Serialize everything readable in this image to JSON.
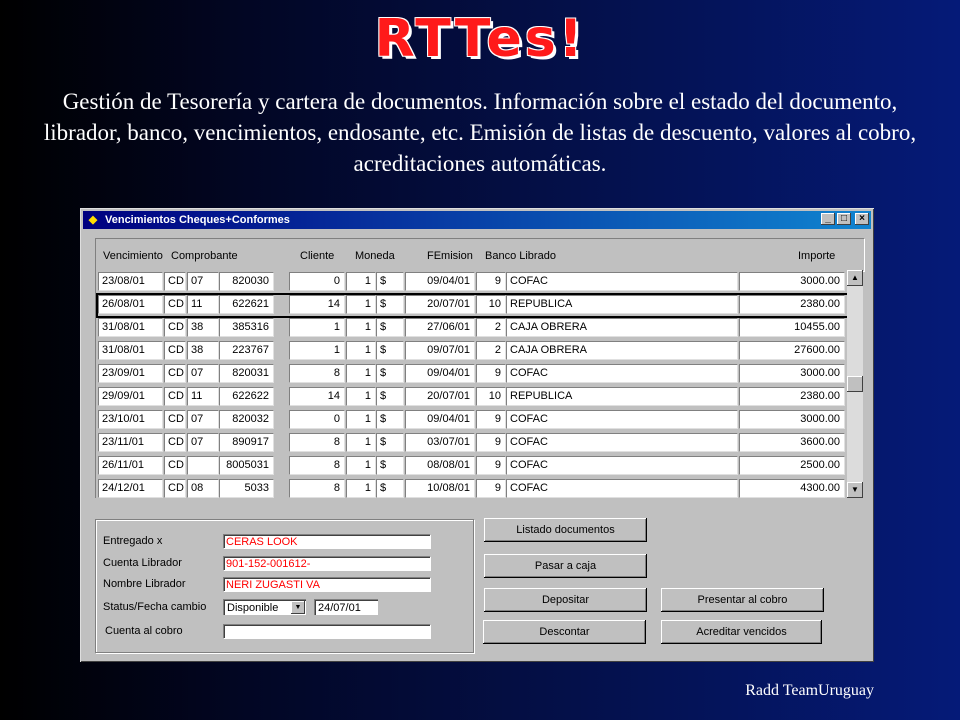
{
  "slide": {
    "title": "RTTes!",
    "description": "Gestión de Tesorería y cartera de documentos.  Información sobre el estado del documento, librador, banco, vencimientos, endosante, etc. Emisión de listas de descuento, valores al cobro, acreditaciones automáticas.",
    "footer": "Radd TeamUruguay"
  },
  "window": {
    "title": "Vencimientos Cheques+Conformes",
    "minimize": "_",
    "maximize": "□",
    "close": "×"
  },
  "columns": {
    "vencimiento": "Vencimiento",
    "comprobante": "Comprobante",
    "cliente": "Cliente",
    "moneda": "Moneda",
    "femision": "FEmision",
    "banco": "Banco Librado",
    "importe": "Importe"
  },
  "rows": [
    {
      "venc": "23/08/01",
      "tipo": "CD",
      "serie": "07",
      "numero": "820030",
      "cliente": "0",
      "mon": "1",
      "signo": "$",
      "femision": "09/04/01",
      "bcod": "9",
      "banco": "COFAC",
      "importe": "3000.00"
    },
    {
      "venc": "26/08/01",
      "tipo": "CD",
      "serie": "11",
      "numero": "622621",
      "cliente": "14",
      "mon": "1",
      "signo": "$",
      "femision": "20/07/01",
      "bcod": "10",
      "banco": "REPUBLICA",
      "importe": "2380.00"
    },
    {
      "venc": "31/08/01",
      "tipo": "CD",
      "serie": "38",
      "numero": "385316",
      "cliente": "1",
      "mon": "1",
      "signo": "$",
      "femision": "27/06/01",
      "bcod": "2",
      "banco": "CAJA OBRERA",
      "importe": "10455.00"
    },
    {
      "venc": "31/08/01",
      "tipo": "CD",
      "serie": "38",
      "numero": "223767",
      "cliente": "1",
      "mon": "1",
      "signo": "$",
      "femision": "09/07/01",
      "bcod": "2",
      "banco": "CAJA OBRERA",
      "importe": "27600.00"
    },
    {
      "venc": "23/09/01",
      "tipo": "CD",
      "serie": "07",
      "numero": "820031",
      "cliente": "8",
      "mon": "1",
      "signo": "$",
      "femision": "09/04/01",
      "bcod": "9",
      "banco": "COFAC",
      "importe": "3000.00"
    },
    {
      "venc": "29/09/01",
      "tipo": "CD",
      "serie": "11",
      "numero": "622622",
      "cliente": "14",
      "mon": "1",
      "signo": "$",
      "femision": "20/07/01",
      "bcod": "10",
      "banco": "REPUBLICA",
      "importe": "2380.00"
    },
    {
      "venc": "23/10/01",
      "tipo": "CD",
      "serie": "07",
      "numero": "820032",
      "cliente": "0",
      "mon": "1",
      "signo": "$",
      "femision": "09/04/01",
      "bcod": "9",
      "banco": "COFAC",
      "importe": "3000.00"
    },
    {
      "venc": "23/11/01",
      "tipo": "CD",
      "serie": "07",
      "numero": "890917",
      "cliente": "8",
      "mon": "1",
      "signo": "$",
      "femision": "03/07/01",
      "bcod": "9",
      "banco": "COFAC",
      "importe": "3600.00"
    },
    {
      "venc": "26/11/01",
      "tipo": "CD",
      "serie": "",
      "numero": "8005031",
      "cliente": "8",
      "mon": "1",
      "signo": "$",
      "femision": "08/08/01",
      "bcod": "9",
      "banco": "COFAC",
      "importe": "2500.00"
    },
    {
      "venc": "24/12/01",
      "tipo": "CD",
      "serie": "08",
      "numero": "5033",
      "cliente": "8",
      "mon": "1",
      "signo": "$",
      "femision": "10/08/01",
      "bcod": "9",
      "banco": "COFAC",
      "importe": "4300.00"
    }
  ],
  "form": {
    "entregado_label": "Entregado x",
    "entregado_value": "CERAS LOOK",
    "cuenta_label": "Cuenta Librador",
    "cuenta_value": "901-152-001612-",
    "nombre_label": "Nombre Librador",
    "nombre_value": "NERI ZUGASTI VA",
    "status_label": "Status/Fecha cambio",
    "status_value": "Disponible",
    "fecha_value": "24/07/01",
    "cobro_label": "Cuenta al cobro",
    "cobro_value": ""
  },
  "buttons": {
    "listado": "Listado documentos",
    "pasar": "Pasar a caja",
    "depositar": "Depositar",
    "presentar": "Presentar al cobro",
    "descontar": "Descontar",
    "acreditar": "Acreditar vencidos"
  },
  "colors": {
    "field_text": "#ff0000",
    "title_red": "#ff1a1a",
    "titlebar": "#000080"
  }
}
